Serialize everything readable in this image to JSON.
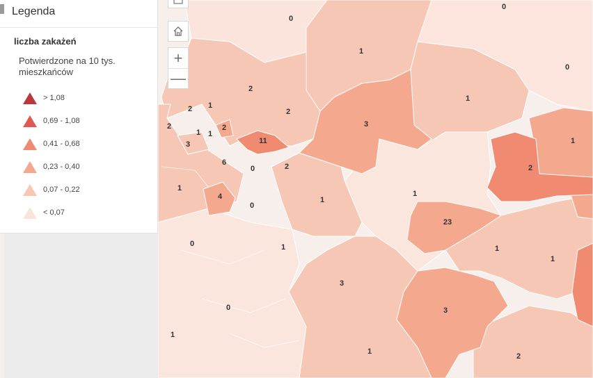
{
  "legend": {
    "title": "Legenda",
    "layer_title": "liczba zakażeń",
    "field_title": "Potwierdzone na 10 tys. mieszkańców",
    "classes": [
      {
        "label": "> 1,08",
        "color": "#b83a3e"
      },
      {
        "label": "0,69 - 1,08",
        "color": "#df5a52"
      },
      {
        "label": "0,41 - 0,68",
        "color": "#f08b72"
      },
      {
        "label": "0,23 - 0,40",
        "color": "#f4a88e"
      },
      {
        "label": "0,07 - 0,22",
        "color": "#f7c6b4"
      },
      {
        "label": "< 0,07",
        "color": "#fae3da"
      }
    ]
  },
  "controls": {
    "home_icon": "home-icon",
    "zoom_in": "+",
    "zoom_out": "—"
  },
  "map": {
    "regions": [
      {
        "id": "r-0-top",
        "count": "0"
      },
      {
        "id": "r-0-topright",
        "count": "0"
      },
      {
        "id": "r-1-north",
        "count": "1"
      },
      {
        "id": "r-0-east",
        "count": "0"
      },
      {
        "id": "r-2-a",
        "count": "2"
      },
      {
        "id": "r-2-b",
        "count": "2"
      },
      {
        "id": "r-1-a",
        "count": "1"
      },
      {
        "id": "r-2-c",
        "count": "2"
      },
      {
        "id": "r-1-ne",
        "count": "1"
      },
      {
        "id": "r-3-north",
        "count": "3"
      },
      {
        "id": "r-2-d",
        "count": "2"
      },
      {
        "id": "r-2-e",
        "count": "2"
      },
      {
        "id": "r-1-b",
        "count": "1"
      },
      {
        "id": "r-1-c",
        "count": "1"
      },
      {
        "id": "r-3-west",
        "count": "3"
      },
      {
        "id": "r-11",
        "count": "11"
      },
      {
        "id": "r-1-far-east",
        "count": "1"
      },
      {
        "id": "r-6",
        "count": "6"
      },
      {
        "id": "r-0-a",
        "count": "0"
      },
      {
        "id": "r-2-f",
        "count": "2"
      },
      {
        "id": "r-2-east",
        "count": "2"
      },
      {
        "id": "r-1-d",
        "count": "1"
      },
      {
        "id": "r-4",
        "count": "4"
      },
      {
        "id": "r-0-b",
        "count": "0"
      },
      {
        "id": "r-1-e",
        "count": "1"
      },
      {
        "id": "r-1-centre",
        "count": "1"
      },
      {
        "id": "r-23",
        "count": "23"
      },
      {
        "id": "r-0-c",
        "count": "0"
      },
      {
        "id": "r-1-f",
        "count": "1"
      },
      {
        "id": "r-1-g",
        "count": "1"
      },
      {
        "id": "r-1-h",
        "count": "1"
      },
      {
        "id": "r-3-south",
        "count": "3"
      },
      {
        "id": "r-3-south2",
        "count": "3"
      },
      {
        "id": "r-0-d",
        "count": "0"
      },
      {
        "id": "r-1-sw",
        "count": "1"
      },
      {
        "id": "r-1-s",
        "count": "1"
      },
      {
        "id": "r-2-se",
        "count": "2"
      }
    ]
  }
}
